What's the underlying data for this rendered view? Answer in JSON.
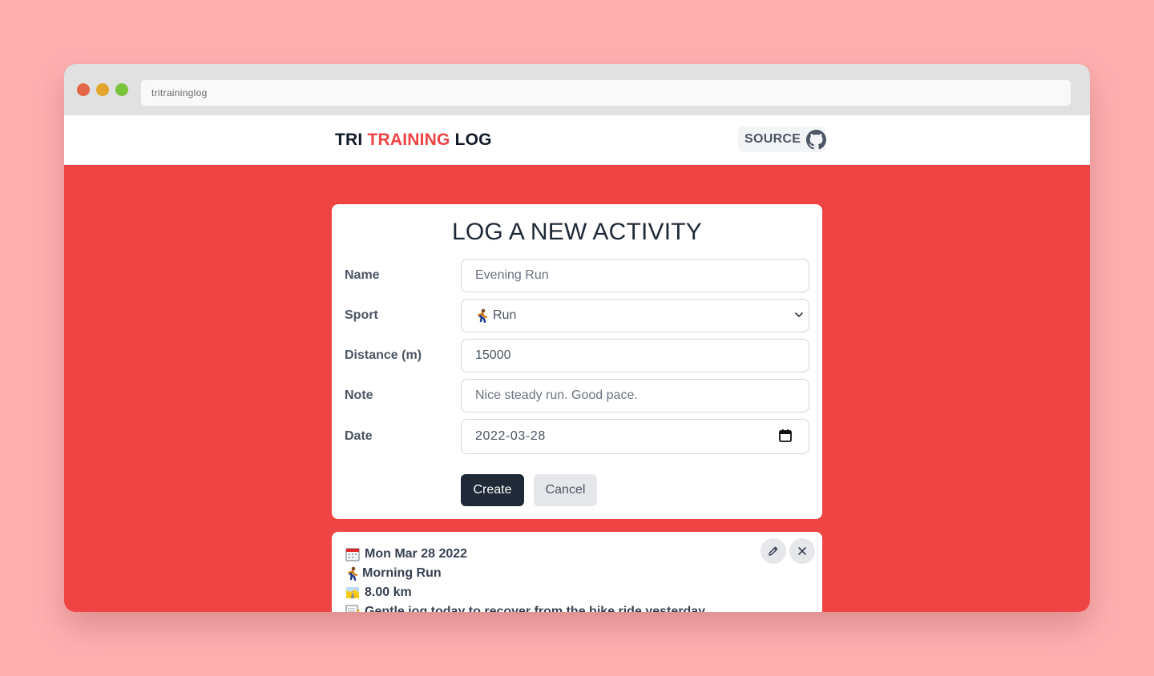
{
  "browser": {
    "url": "tritraininglog"
  },
  "navbar": {
    "brand_part1": "TRI",
    "brand_part2": "TRAINING",
    "brand_part3": "LOG",
    "source_label": "SOURCE"
  },
  "form": {
    "title": "LOG A NEW ACTIVITY",
    "name_label": "Name",
    "name_placeholder": "Evening Run",
    "sport_label": "Sport",
    "sport_selected": "Run",
    "distance_label": "Distance (m)",
    "distance_value": "15000",
    "note_label": "Note",
    "note_placeholder": "Nice steady run. Good pace.",
    "date_label": "Date",
    "date_value": "2022-03-28",
    "create_label": "Create",
    "cancel_label": "Cancel"
  },
  "activity": {
    "date": "Mon Mar 28 2022",
    "name": "Morning Run",
    "distance": "8.00 km",
    "note": "Gentle jog today to recover from the bike ride yesterday."
  },
  "colors": {
    "accent": "#ef4444",
    "dark_button": "#1f2937",
    "page_background": "#feb0b1"
  }
}
